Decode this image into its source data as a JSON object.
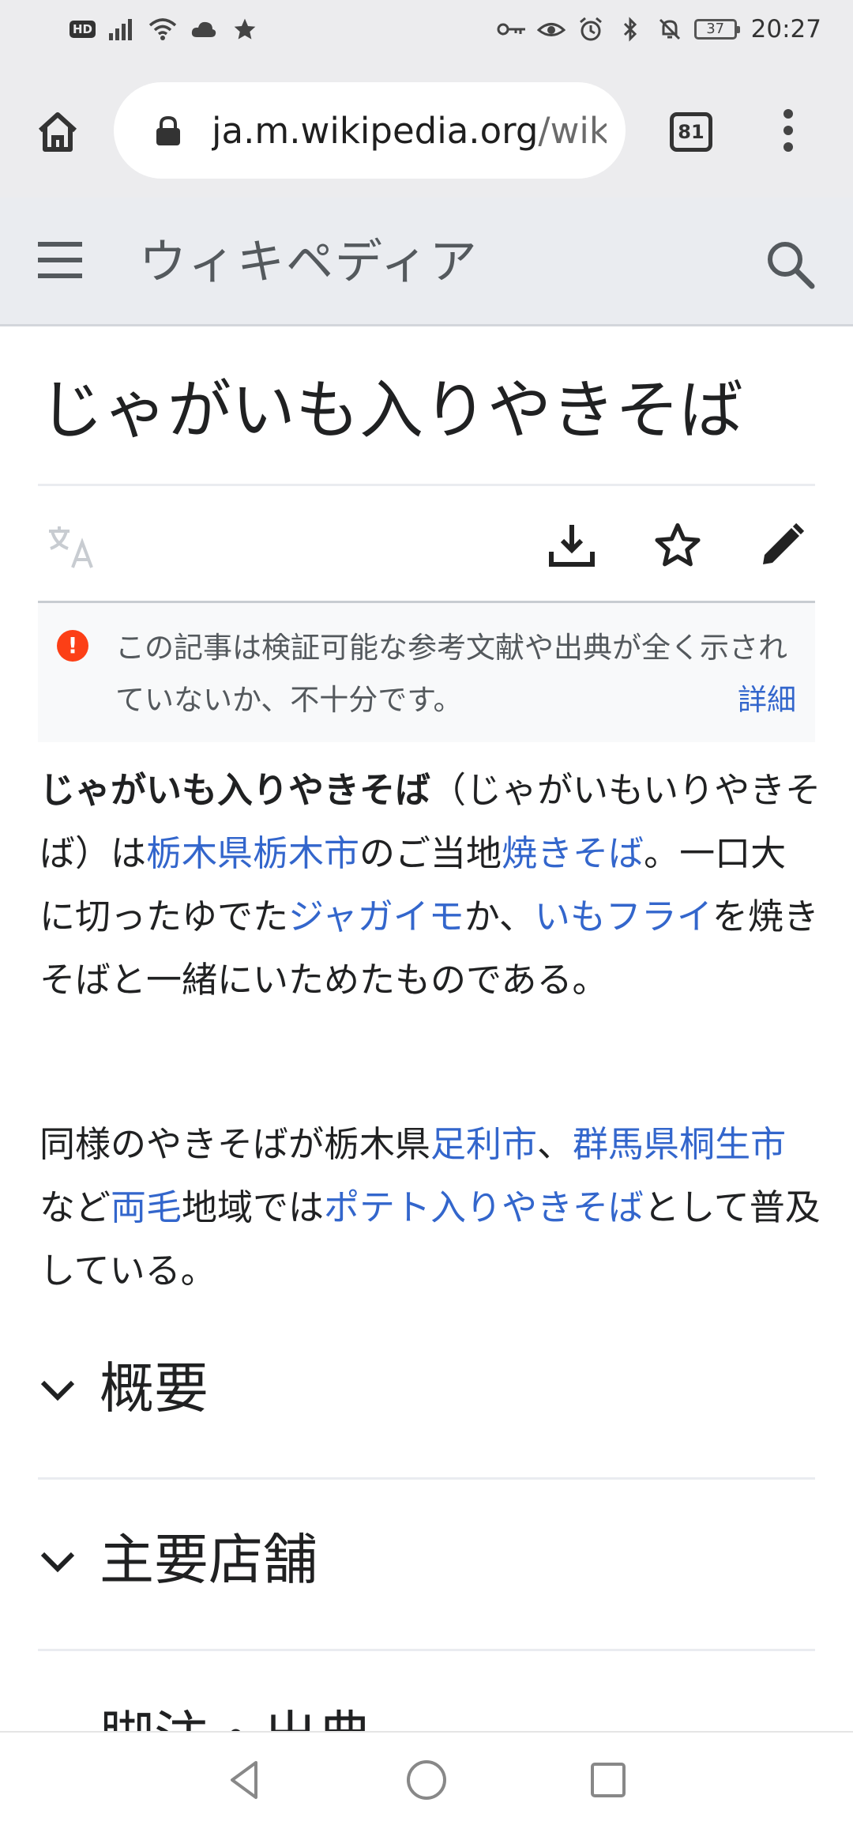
{
  "status_bar": {
    "hd_badge": "HD",
    "battery": "37",
    "time": "20:27",
    "left_icons": [
      "signal-icon",
      "wifi-icon",
      "cloud-icon",
      "star-icon"
    ],
    "right_icons": [
      "key-icon",
      "eye-icon",
      "alarm-icon",
      "bluetooth-icon",
      "mute-icon"
    ]
  },
  "browser": {
    "url_host": "ja.m.wikipedia.org",
    "url_path": "/wiki",
    "tab_count": "81"
  },
  "wiki_header": {
    "logo": "ウィキペディア"
  },
  "article": {
    "title": "じゃがいも入りやきそば",
    "notice": {
      "text": "この記事は検証可能な参考文献や出典が全く示されていないか、不十分です。",
      "more_link": "詳細"
    },
    "para1": {
      "bold_term": "じゃがいも入りやきそば",
      "t1": "（じゃがいもいりやきそば）は",
      "link1": "栃木県",
      "link2": "栃木市",
      "t2": "のご当地",
      "link3": "焼きそば",
      "t3": "。一口大に切ったゆでた",
      "link4": "ジャガイモ",
      "t4": "か、",
      "link5": "いもフライ",
      "t5": "を焼きそばと一緒にいためたものである。"
    },
    "para2": {
      "t1": "同様のやきそばが栃木県",
      "link1": "足利市",
      "t2": "、",
      "link2": "群馬県",
      "link3": "桐生市",
      "t3": "など",
      "link4": "両毛",
      "t4": "地域では",
      "link5": "ポテト入りやきそば",
      "t5": "として普及している。"
    },
    "sections": [
      {
        "title": "概要"
      },
      {
        "title": "主要店舗"
      },
      {
        "title": "脚注・出典"
      }
    ]
  },
  "colors": {
    "link": "#3366cc",
    "notice_icon": "#fc3f16",
    "header_bg": "#eaecf0"
  }
}
